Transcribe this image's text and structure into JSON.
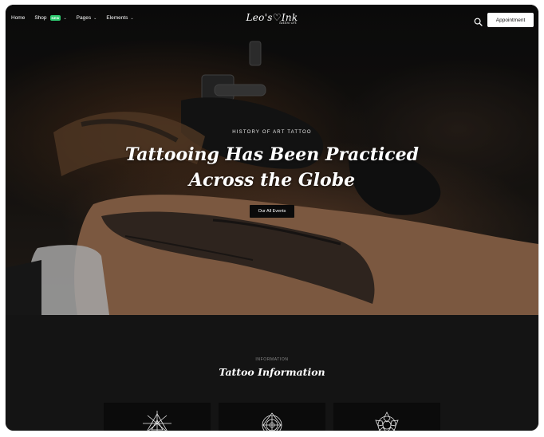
{
  "nav": {
    "items": [
      {
        "label": "Home",
        "has_dropdown": false
      },
      {
        "label": "Shop",
        "badge": "NEW",
        "has_dropdown": true
      },
      {
        "label": "Pages",
        "has_dropdown": true
      },
      {
        "label": "Elements",
        "has_dropdown": true
      }
    ],
    "logo_main": "Leo's♡Ink",
    "logo_sub": "tattoo art",
    "search_icon": "search-icon",
    "appointment_label": "Appointment"
  },
  "hero": {
    "eyebrow": "HISTORY OF ART TATTOO",
    "title_line1": "Tattooing Has Been Practiced",
    "title_line2": "Across the Globe",
    "cta_label": "Our All Events"
  },
  "info": {
    "eyebrow": "INFORMATION",
    "title": "Tattoo Information",
    "cards": [
      {
        "icon": "geometric-triangle-icon"
      },
      {
        "icon": "mandala-icon"
      },
      {
        "icon": "lotus-mandala-icon"
      }
    ]
  },
  "colors": {
    "background": "#151515",
    "badge": "#2ecc71",
    "button_light": "#ffffff",
    "button_dark": "#0a0a0a"
  }
}
